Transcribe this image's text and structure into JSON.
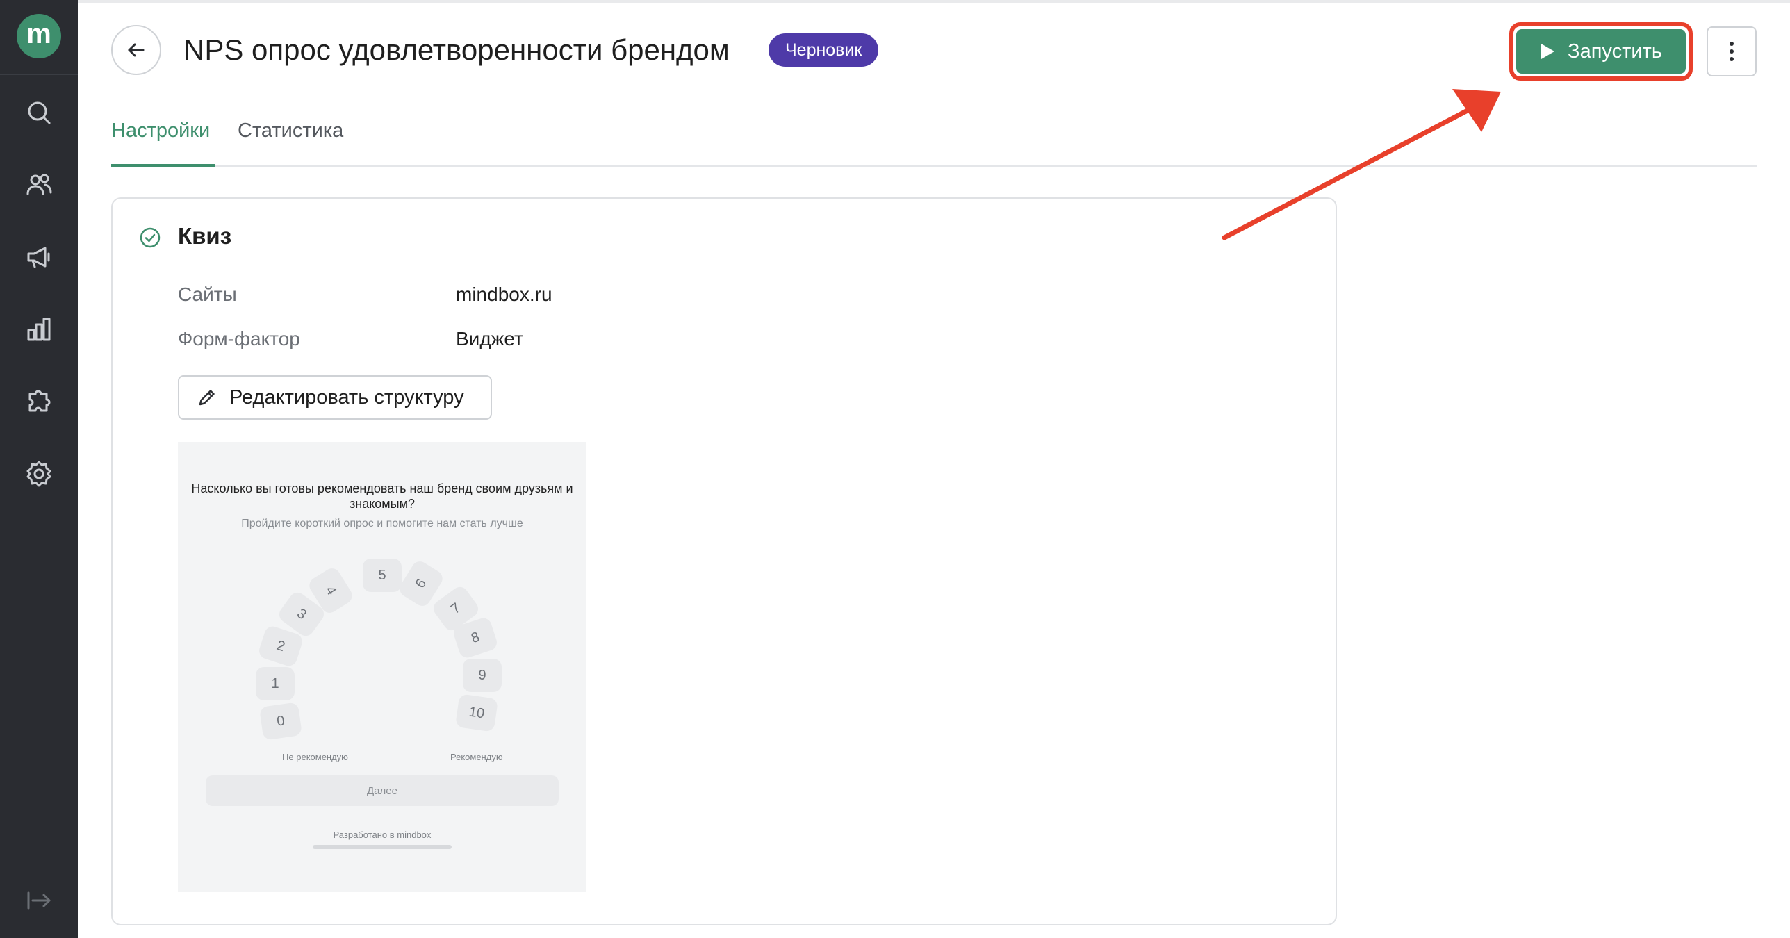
{
  "app": {
    "logo_letter": "m"
  },
  "sidebar": {
    "items": [
      {
        "name": "search-icon"
      },
      {
        "name": "users-icon"
      },
      {
        "name": "megaphone-icon"
      },
      {
        "name": "bar-chart-icon"
      },
      {
        "name": "puzzle-icon"
      },
      {
        "name": "gear-icon"
      }
    ],
    "collapse_icon": "collapse-sidebar-icon"
  },
  "header": {
    "title": "NPS опрос удовлетворенности брендом",
    "status": "Черновик",
    "launch_label": "Запустить"
  },
  "tabs": [
    {
      "label": "Настройки",
      "active": true
    },
    {
      "label": "Статистика",
      "active": false
    }
  ],
  "card": {
    "title": "Квиз",
    "fields": [
      {
        "label": "Сайты",
        "value": "mindbox.ru"
      },
      {
        "label": "Форм-фактор",
        "value": "Виджет"
      }
    ],
    "edit_label": "Редактировать структуру"
  },
  "preview": {
    "question": "Насколько вы готовы рекомендовать наш бренд своим друзьям и знакомым?",
    "subtitle": "Пройдите короткий опрос и помогите нам стать лучше",
    "scores": [
      "0",
      "1",
      "2",
      "3",
      "4",
      "5",
      "6",
      "7",
      "8",
      "9",
      "10"
    ],
    "low_label": "Не рекомендую",
    "high_label": "Рекомендую",
    "next_label": "Далее",
    "brand": "Разработано в mindbox"
  },
  "colors": {
    "accent": "#3e8f6d",
    "badge": "#4e3aa8",
    "sidebar": "#2a2c31",
    "annotation": "#e8402b"
  }
}
